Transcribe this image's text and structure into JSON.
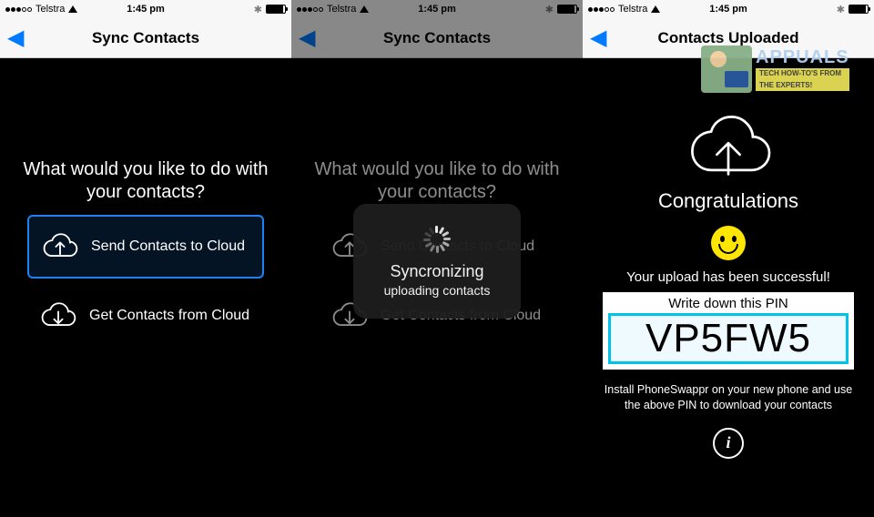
{
  "statusbar": {
    "carrier": "Telstra",
    "time": "1:45 pm"
  },
  "screen1": {
    "nav_title": "Sync Contacts",
    "prompt": "What would you like to do with your contacts?",
    "option_send": "Send Contacts to Cloud",
    "option_get": "Get Contacts from Cloud"
  },
  "screen2": {
    "nav_title": "Sync Contacts",
    "prompt": "What would you like to do with your contacts?",
    "option_send": "Send Contacts to Cloud",
    "option_get": "Get Contacts from Cloud",
    "hud_title": "Syncronizing",
    "hud_sub": "uploading contacts"
  },
  "screen3": {
    "nav_title": "Contacts Uploaded",
    "congrats": "Congratulations",
    "success": "Your upload has been successful!",
    "pin_label": "Write down this PIN",
    "pin_value": "VP5FW5",
    "install_msg": "Install PhoneSwappr on your new phone and use the above PIN to download your contacts",
    "info_char": "i"
  },
  "watermark": {
    "title": "APPUALS",
    "sub1": "TECH HOW-TO'S FROM",
    "sub2": "THE EXPERTS!"
  }
}
